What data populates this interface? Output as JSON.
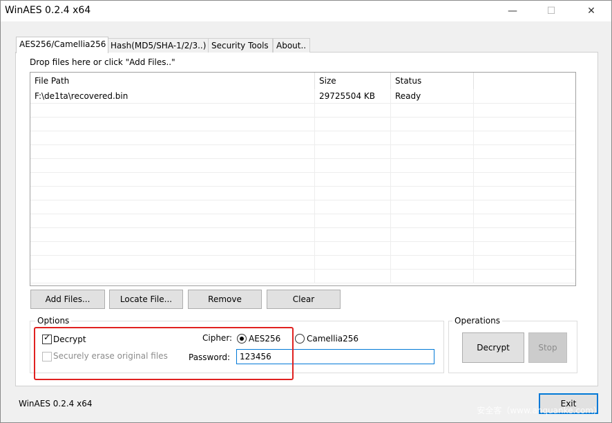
{
  "window": {
    "title": "WinAES 0.2.4 x64",
    "minimize": "—",
    "maximize": "☐",
    "close": "✕"
  },
  "tabs": [
    {
      "label": "AES256/Camellia256",
      "active": true
    },
    {
      "label": "Hash(MD5/SHA-1/2/3..)"
    },
    {
      "label": "Security Tools"
    },
    {
      "label": "About.."
    }
  ],
  "drop_hint": "Drop files here or click \"Add Files..\"",
  "file_list": {
    "columns": [
      "File Path",
      "Size",
      "Status"
    ],
    "rows": [
      {
        "path": "F:\\de1ta\\recovered.bin",
        "size": "29725504 KB",
        "status": "Ready"
      }
    ]
  },
  "buttons": {
    "add_files": "Add Files...",
    "locate_file": "Locate File...",
    "remove": "Remove",
    "clear": "Clear"
  },
  "options": {
    "label": "Options",
    "decrypt_checkbox": "Decrypt",
    "decrypt_checked": true,
    "secure_erase": "Securely erase original files",
    "cipher_label": "Cipher:",
    "cipher_aes": "AES256",
    "cipher_camellia": "Camellia256",
    "selected_cipher": "AES256",
    "password_label": "Password:",
    "password_value": "123456"
  },
  "operations": {
    "label": "Operations",
    "decrypt_button": "Decrypt",
    "stop_button": "Stop"
  },
  "footer": {
    "version_label": "WinAES 0.2.4 x64",
    "exit_button": "Exit",
    "watermark": "安全客（www.anquanke.com）"
  },
  "colors": {
    "accent": "#0078d7",
    "highlight": "#e0201f"
  }
}
